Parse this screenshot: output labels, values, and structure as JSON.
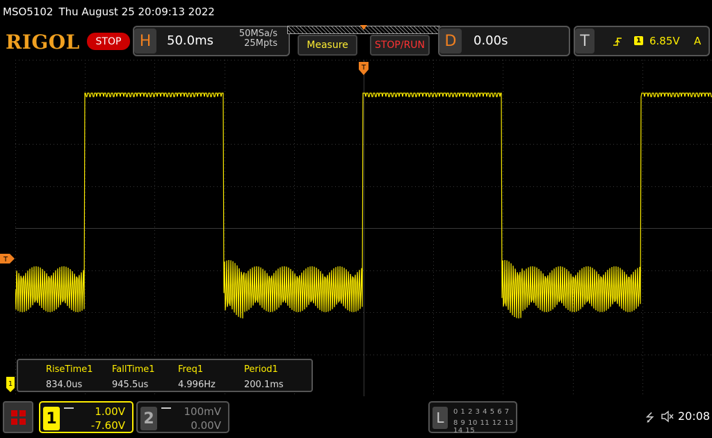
{
  "title_bar": {
    "model": "MSO5102",
    "datetime": "Thu August 25 20:09:13 2022"
  },
  "header": {
    "logo": "RIGOL",
    "run_state": "STOP",
    "horizontal": {
      "letter": "H",
      "timebase": "50.0ms",
      "sample_rate": "50MSa/s",
      "memory_depth": "25Mpts"
    },
    "measure_label": "Measure",
    "stoprun_label": "STOP/RUN",
    "delay": {
      "letter": "D",
      "value": "0.00s"
    },
    "trigger": {
      "letter": "T",
      "source": "1",
      "level": "6.85V",
      "mode": "A"
    }
  },
  "markers": {
    "trigger_marker": "T",
    "ch1_marker": "1",
    "trigger_position": "T"
  },
  "measurements": [
    {
      "label": "RiseTime1",
      "value": "834.0us"
    },
    {
      "label": "FallTime1",
      "value": "945.5us"
    },
    {
      "label": "Freq1",
      "value": "4.996Hz"
    },
    {
      "label": "Period1",
      "value": "200.1ms"
    }
  ],
  "channels": {
    "ch1": {
      "number": "1",
      "scale": "1.00V",
      "offset": "-7.60V"
    },
    "ch2": {
      "number": "2",
      "scale": "100mV",
      "offset": "0.00V"
    }
  },
  "logic_analyzer": {
    "letter": "L",
    "row1": "0 1 2 3  4 5 6 7",
    "row2": "8 9 10 11 12 13 14 15"
  },
  "status": {
    "time": "20:08",
    "usb": "⭍"
  },
  "colors": {
    "ch1": "#ffee00",
    "accent": "#f08020",
    "stop": "#cc0000",
    "grid": "#3a3a3a"
  }
}
